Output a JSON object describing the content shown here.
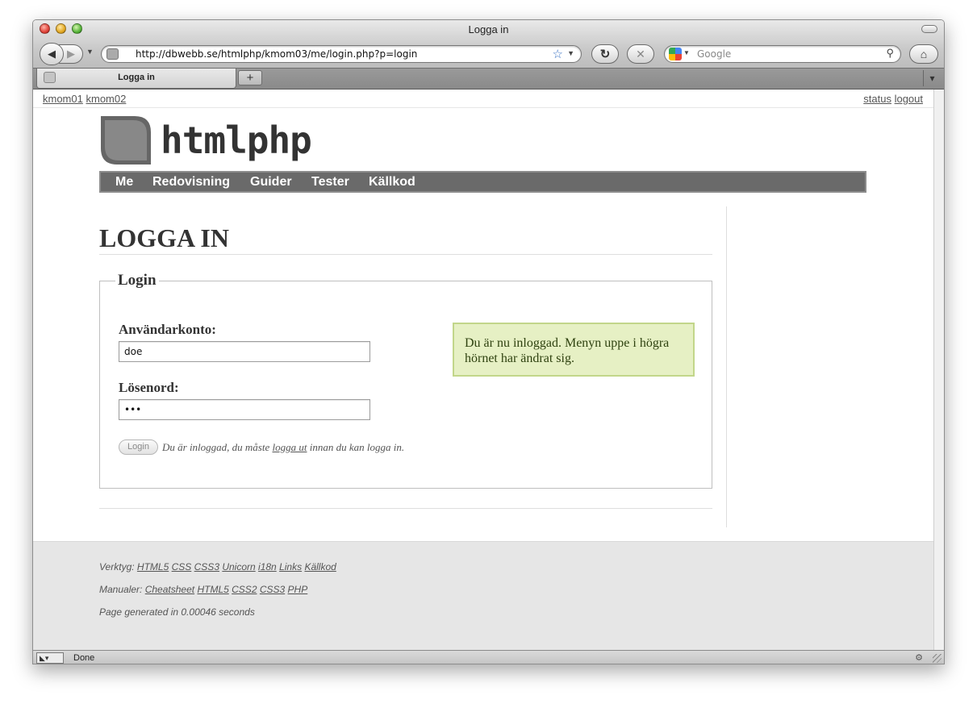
{
  "browser": {
    "window_title": "Logga in",
    "url": "http://dbwebb.se/htmlphp/kmom03/me/login.php?p=login",
    "search_placeholder": "Google",
    "tab_label": "Logga in",
    "newtab_label": "+",
    "status_text": "Done",
    "icons": {
      "back": "◀",
      "forward": "▶",
      "dropdown": "▼",
      "reload": "↻",
      "stop": "✕",
      "search": "⚲",
      "home": "⌂",
      "star": "☆",
      "tabmenu": "▾",
      "status_arrow": "◣▾",
      "status_right": "⚙"
    }
  },
  "page": {
    "top_links_left": [
      "kmom01",
      "kmom02"
    ],
    "top_links_right": [
      "status",
      "logout"
    ],
    "site_title": "htmlphp",
    "menu": [
      "Me",
      "Redovisning",
      "Guider",
      "Tester",
      "Källkod"
    ],
    "heading": "LOGGA IN",
    "form": {
      "legend": "Login",
      "username_label": "Användarkonto:",
      "username_value": "doe",
      "password_label": "Lösenord:",
      "password_value": "•••",
      "submit_label": "Login",
      "message_before": "Du är inloggad, du måste ",
      "message_link": "logga ut",
      "message_after": " innan du kan logga in."
    },
    "notice": "Du är nu inloggad. Menyn uppe i högra hörnet har ändrat sig.",
    "footer": {
      "tools_label": "Verktyg:",
      "tools": [
        "HTML5",
        "CSS",
        "CSS3",
        "Unicorn",
        "i18n",
        "Links",
        "Källkod"
      ],
      "manuals_label": "Manualer:",
      "manuals": [
        "Cheatsheet",
        "HTML5",
        "CSS2",
        "CSS3",
        "PHP"
      ],
      "generated": "Page generated in 0.00046 seconds"
    }
  },
  "colors": {
    "menubar": "#6a6a6a",
    "notice_bg": "#e6f0c4",
    "notice_border": "#c2d68a",
    "footer_bg": "#e6e6e6"
  }
}
